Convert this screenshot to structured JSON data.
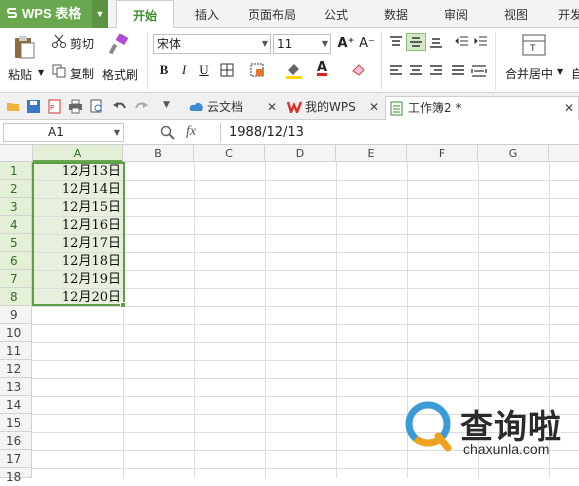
{
  "app": {
    "name": "WPS 表格"
  },
  "menu_tabs": [
    "开始",
    "插入",
    "页面布局",
    "公式",
    "数据",
    "审阅",
    "视图",
    "开发"
  ],
  "active_tab": "开始",
  "ribbon": {
    "paste": "粘贴",
    "cut": "剪切",
    "copy": "复制",
    "format_painter": "格式刷",
    "font_name": "宋体",
    "font_size": "11",
    "bold": "B",
    "italic": "I",
    "underline": "U",
    "font_color_letter": "A",
    "grow_font": "A⁺",
    "shrink_font": "A⁻",
    "merge_center": "合并居中",
    "auto_wrap_partial": "自"
  },
  "doc_tabs": [
    {
      "label": "云文档"
    },
    {
      "label": "我的WPS"
    },
    {
      "label": "工作簿2 *"
    }
  ],
  "formula_bar": {
    "name_box": "A1",
    "fx": "fx",
    "formula": "1988/12/13"
  },
  "columns": [
    "A",
    "B",
    "C",
    "D",
    "E",
    "F",
    "G"
  ],
  "rows": [
    "1",
    "2",
    "3",
    "4",
    "5",
    "6",
    "7",
    "8",
    "9",
    "10",
    "11",
    "12",
    "13",
    "14",
    "15",
    "16",
    "17",
    "18"
  ],
  "cells_A": [
    "12月13日",
    "12月14日",
    "12月15日",
    "12月16日",
    "12月17日",
    "12月18日",
    "12月19日",
    "12月20日"
  ],
  "watermark": {
    "name": "查询啦",
    "url": "chaxunla.com"
  },
  "colors": {
    "accent": "#6aa84f",
    "selection": "#5e9c47",
    "selected_fill": "#e6f0dc"
  }
}
